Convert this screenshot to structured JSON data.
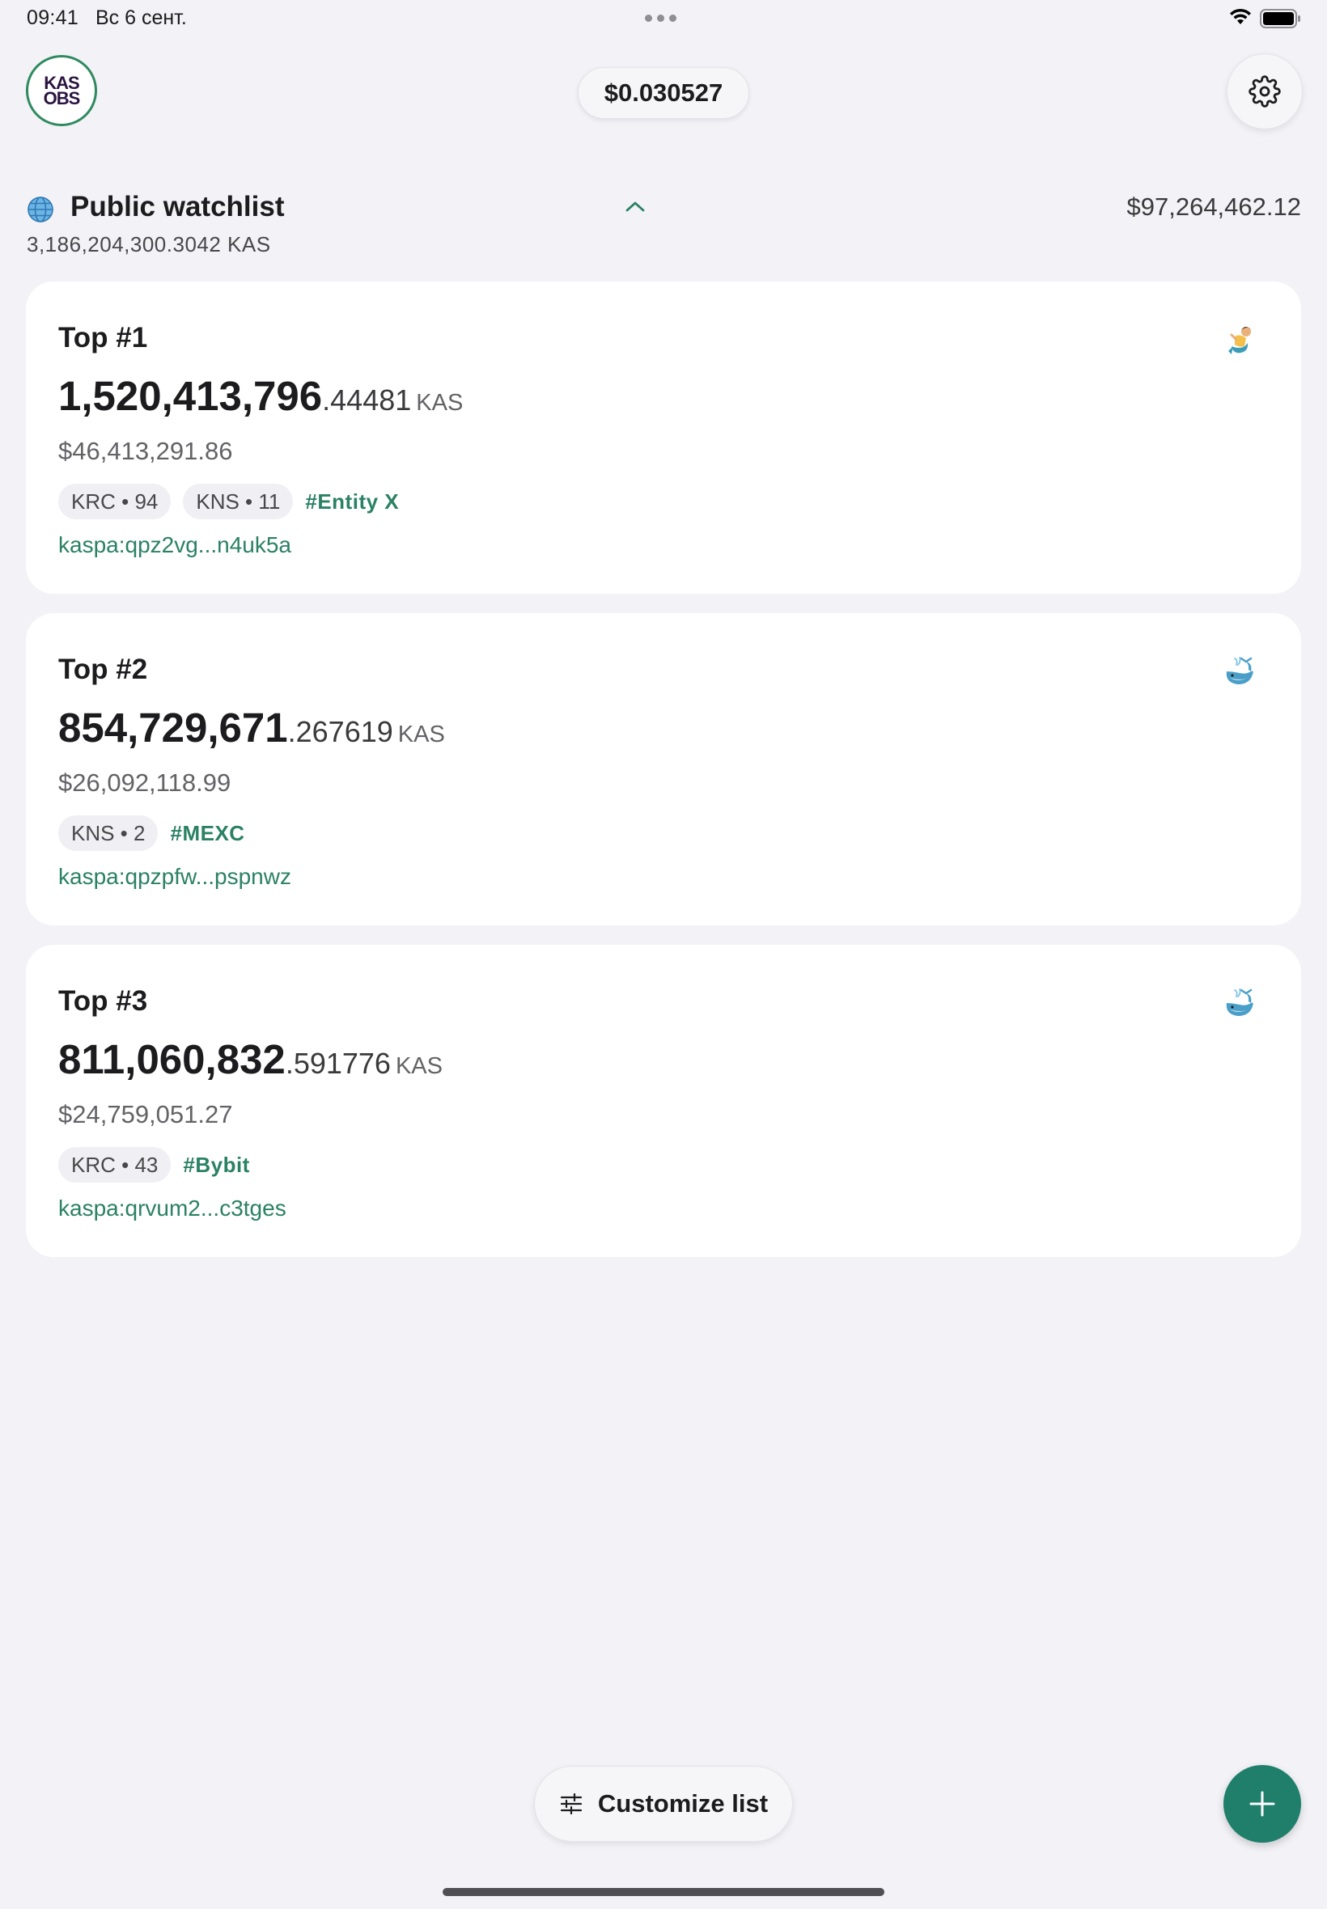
{
  "status_bar": {
    "time": "09:41",
    "date": "Вс 6 сент."
  },
  "header": {
    "logo_line1": "KAS",
    "logo_line2": "OBS",
    "price": "$0.030527"
  },
  "watchlist": {
    "title": "Public watchlist",
    "total_usd": "$97,264,462.12",
    "total_kas": "3,186,204,300.3042 KAS",
    "expanded": true
  },
  "cards": [
    {
      "title": "Top #1",
      "amount_int": "1,520,413,796",
      "amount_dec": ".44481",
      "unit": "KAS",
      "usd": "$46,413,291.86",
      "tags": [
        "KRC • 94",
        "KNS • 11"
      ],
      "hashtag": "#Entity X",
      "address": "kaspa:qpz2vg...n4uk5a",
      "icon": "merperson-emoji-icon"
    },
    {
      "title": "Top #2",
      "amount_int": "854,729,671",
      "amount_dec": ".267619",
      "unit": "KAS",
      "usd": "$26,092,118.99",
      "tags": [
        "KNS • 2"
      ],
      "hashtag": "#MEXC",
      "address": "kaspa:qpzpfw...pspnwz",
      "icon": "whale-emoji-icon"
    },
    {
      "title": "Top #3",
      "amount_int": "811,060,832",
      "amount_dec": ".591776",
      "unit": "KAS",
      "usd": "$24,759,051.27",
      "tags": [
        "KRC • 43"
      ],
      "hashtag": "#Bybit",
      "address": "kaspa:qrvum2...c3tges",
      "icon": "whale-emoji-icon"
    }
  ],
  "bottom": {
    "customize_label": "Customize list"
  },
  "colors": {
    "accent": "#1f7f6b",
    "link": "#2a8164",
    "background": "#f2f2f7"
  }
}
